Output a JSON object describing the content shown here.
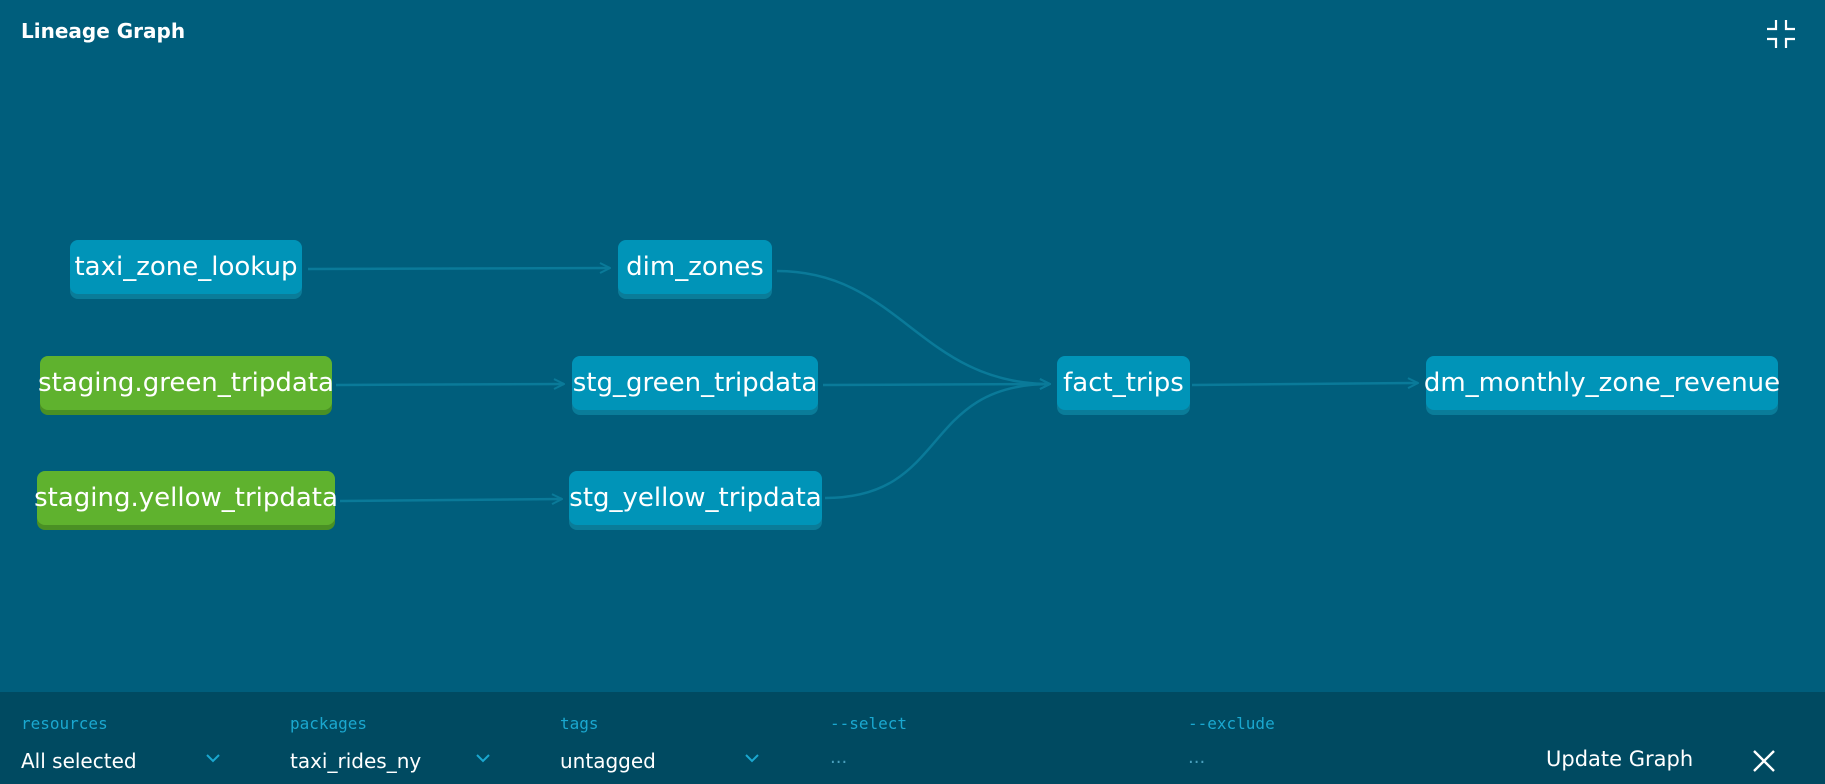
{
  "header": {
    "title": "Lineage Graph",
    "collapse_icon": "collapse-icon"
  },
  "graph": {
    "nodes": [
      {
        "id": "taxi_zone_lookup",
        "label": "taxi_zone_lookup",
        "kind": "model"
      },
      {
        "id": "staging_green_tripdata",
        "label": "staging.green_tripdata",
        "kind": "source"
      },
      {
        "id": "staging_yellow_tripdata",
        "label": "staging.yellow_tripdata",
        "kind": "source"
      },
      {
        "id": "dim_zones",
        "label": "dim_zones",
        "kind": "model"
      },
      {
        "id": "stg_green_tripdata",
        "label": "stg_green_tripdata",
        "kind": "model"
      },
      {
        "id": "stg_yellow_tripdata",
        "label": "stg_yellow_tripdata",
        "kind": "model"
      },
      {
        "id": "fact_trips",
        "label": "fact_trips",
        "kind": "model"
      },
      {
        "id": "dm_monthly_zone_revenue",
        "label": "dm_monthly_zone_revenue",
        "kind": "model"
      }
    ],
    "edges": [
      [
        "taxi_zone_lookup",
        "dim_zones"
      ],
      [
        "staging_green_tripdata",
        "stg_green_tripdata"
      ],
      [
        "staging_yellow_tripdata",
        "stg_yellow_tripdata"
      ],
      [
        "dim_zones",
        "fact_trips"
      ],
      [
        "stg_green_tripdata",
        "fact_trips"
      ],
      [
        "stg_yellow_tripdata",
        "fact_trips"
      ],
      [
        "fact_trips",
        "dm_monthly_zone_revenue"
      ]
    ],
    "colors": {
      "background": "#005e7c",
      "model_node": "#0094b8",
      "source_node": "#5fb22e",
      "edge": "#0a7a99"
    }
  },
  "footer": {
    "resources": {
      "label": "resources",
      "value": "All selected"
    },
    "packages": {
      "label": "packages",
      "value": "taxi_rides_ny"
    },
    "tags": {
      "label": "tags",
      "value": "untagged"
    },
    "select": {
      "label": "--select",
      "placeholder": "..."
    },
    "exclude": {
      "label": "--exclude",
      "placeholder": "..."
    },
    "update_button": "Update Graph",
    "close_icon": "close-icon"
  }
}
